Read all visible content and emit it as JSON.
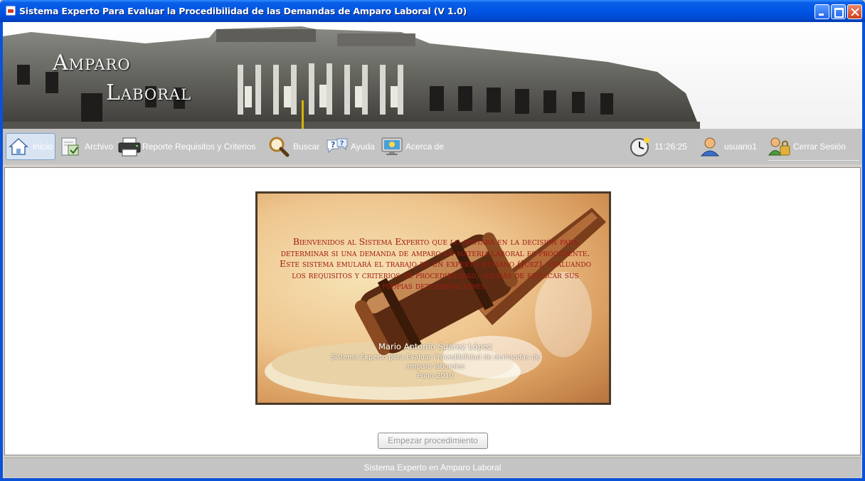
{
  "window": {
    "title": "Sistema Experto Para Evaluar la Procedibilidad de las Demandas de Amparo Laboral (V 1.0)"
  },
  "banner": {
    "title_line1": "Amparo",
    "title_line2": "Laboral"
  },
  "toolbar": {
    "items": [
      {
        "label": "Inicio",
        "icon": "home-icon"
      },
      {
        "label": "Archivo",
        "icon": "archive-icon"
      },
      {
        "label": "Reporte Requisitos y Criterios",
        "icon": "printer-icon"
      },
      {
        "label": "Buscar",
        "icon": "magnifier-icon"
      },
      {
        "label": "Ayuda",
        "icon": "help-icon"
      },
      {
        "label": "Acerca de",
        "icon": "monitor-icon"
      }
    ],
    "clock": "11:26:25",
    "user": "usuario1",
    "logout": "Cerrar Sesión"
  },
  "splash": {
    "welcome_text": "Bienvenidos al Sistema Experto que lo apoyará en la decisión para determinar si una demanda de amparo en materia laboral es procedente. Este sistema emulará el trabajo de  un experto humano (Juez), evaluando los requisitos y criterios de procedibilidad, además de explicar sus propias determinaciones.",
    "author": "Mario Antonio Suárez López",
    "subtitle_line1": "Sistema Experto para Evaluar Procedibilidad de demandas de",
    "subtitle_line2": "amparo laborales",
    "city_year": "Puno-2010"
  },
  "start_button": "Empezar procedimiento",
  "status_bar": "Sistema Experto en Amparo Laboral"
}
